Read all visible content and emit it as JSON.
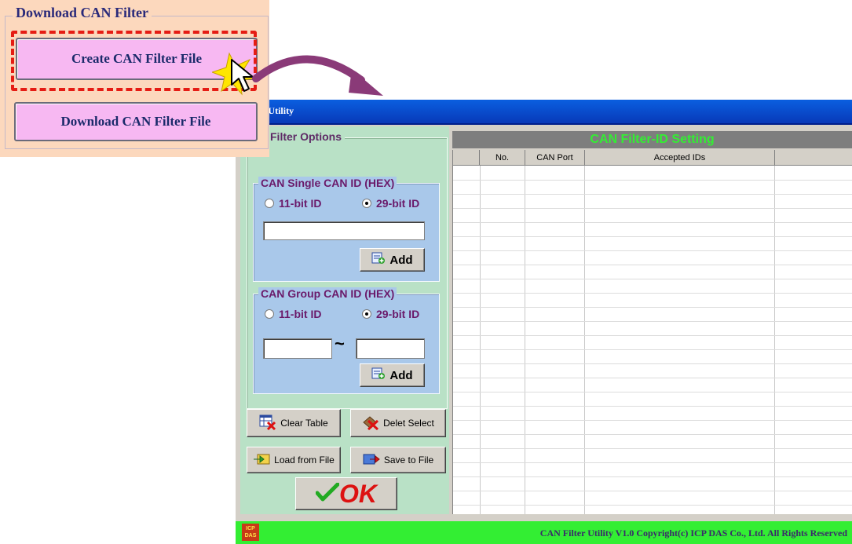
{
  "window": {
    "title": "Filter Utility"
  },
  "options_panel": {
    "title": "N Filter Options",
    "single_group": {
      "title": "CAN Single CAN ID (HEX)",
      "radio_11": "11-bit ID",
      "radio_29": "29-bit ID",
      "selected": "29-bit ID",
      "id_value": "",
      "add_label": "Add"
    },
    "range_group": {
      "title": "CAN Group CAN ID (HEX)",
      "radio_11": "11-bit ID",
      "radio_29": "29-bit ID",
      "selected": "29-bit ID",
      "separator": "~",
      "start_value": "",
      "end_value": "",
      "add_label": "Add"
    },
    "buttons": {
      "clear_table": "Clear Table",
      "delete_select": "Delet Select",
      "load_file": "Load from File",
      "save_file": "Save to File",
      "ok": "OK"
    }
  },
  "table": {
    "title": "CAN Filter-ID Setting",
    "columns": [
      "",
      "No.",
      "CAN Port",
      "Accepted IDs",
      ""
    ],
    "rows": []
  },
  "status_bar": {
    "logo_text": "ICP DAS",
    "text": "CAN Filter Utility  V1.0    Copyright(c) ICP DAS Co., Ltd. All Rights Reserved"
  },
  "inset": {
    "title": "Download CAN Filter",
    "create_button": "Create CAN Filter File",
    "download_button": "Download CAN Filter File"
  },
  "colors": {
    "title_bar": "#0a4fd8",
    "options_bg": "#b9e1c6",
    "group_bg": "#a9c8ea",
    "header_bg": "#7e7e7e",
    "header_text": "#33ee33",
    "status_bg": "#33ee33",
    "inset_bg": "#fcd8bd",
    "inset_button": "#f7b8f2",
    "highlight_dash": "#e51c14",
    "arrow": "#8a3a78",
    "ok_text": "#d11111",
    "check_mark": "#22aa22"
  }
}
